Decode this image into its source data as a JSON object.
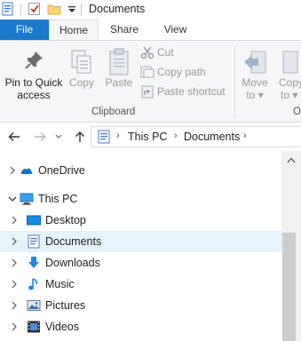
{
  "window": {
    "title": "Documents"
  },
  "quick_access": {
    "icons": [
      "properties-icon",
      "checkmark-icon",
      "new-folder-icon",
      "customize-dropdown-icon"
    ]
  },
  "ribbon": {
    "tabs": [
      {
        "label": "File"
      },
      {
        "label": "Home"
      },
      {
        "label": "Share"
      },
      {
        "label": "View"
      }
    ],
    "clipboard": {
      "pin_label_1": "Pin to Quick",
      "pin_label_2": "access",
      "copy_label": "Copy",
      "paste_label": "Paste",
      "cut_label": "Cut",
      "copy_path_label": "Copy path",
      "paste_shortcut_label": "Paste shortcut",
      "group_label": "Clipboard"
    },
    "organize": {
      "move_to_label_1": "Move",
      "move_to_label_2": "to",
      "copy_to_label_1": "Copy",
      "copy_to_label_2": "to",
      "group_label_partial": "O"
    }
  },
  "address": {
    "crumbs": [
      "This PC",
      "Documents"
    ]
  },
  "nav_pane": {
    "items": [
      {
        "label": "OneDrive",
        "icon": "onedrive-icon",
        "expanded": false,
        "level": 0
      },
      {
        "label": "This PC",
        "icon": "computer-icon",
        "expanded": true,
        "level": 0
      },
      {
        "label": "Desktop",
        "icon": "desktop-folder-icon",
        "expanded": false,
        "level": 1
      },
      {
        "label": "Documents",
        "icon": "documents-folder-icon",
        "expanded": false,
        "level": 1,
        "selected": true
      },
      {
        "label": "Downloads",
        "icon": "downloads-folder-icon",
        "expanded": false,
        "level": 1
      },
      {
        "label": "Music",
        "icon": "music-folder-icon",
        "expanded": false,
        "level": 1
      },
      {
        "label": "Pictures",
        "icon": "pictures-folder-icon",
        "expanded": false,
        "level": 1
      },
      {
        "label": "Videos",
        "icon": "videos-folder-icon",
        "expanded": false,
        "level": 1
      }
    ]
  },
  "colors": {
    "file_tab": "#1979ca",
    "ribbon_bg": "#f5f6f7",
    "selected_row": "#e5f3fb",
    "accent_blue": "#1e88e5"
  }
}
